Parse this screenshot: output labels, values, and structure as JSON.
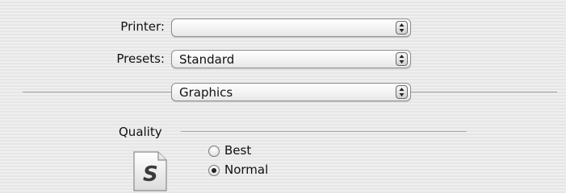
{
  "printer": {
    "label": "Printer:",
    "value": ""
  },
  "presets": {
    "label": "Presets:",
    "value": "Standard"
  },
  "panel": {
    "value": "Graphics"
  },
  "quality": {
    "label": "Quality",
    "icon": "document-s-icon",
    "icon_letter": "S",
    "options": [
      {
        "label": "Best",
        "selected": false
      },
      {
        "label": "Normal",
        "selected": true
      }
    ]
  }
}
